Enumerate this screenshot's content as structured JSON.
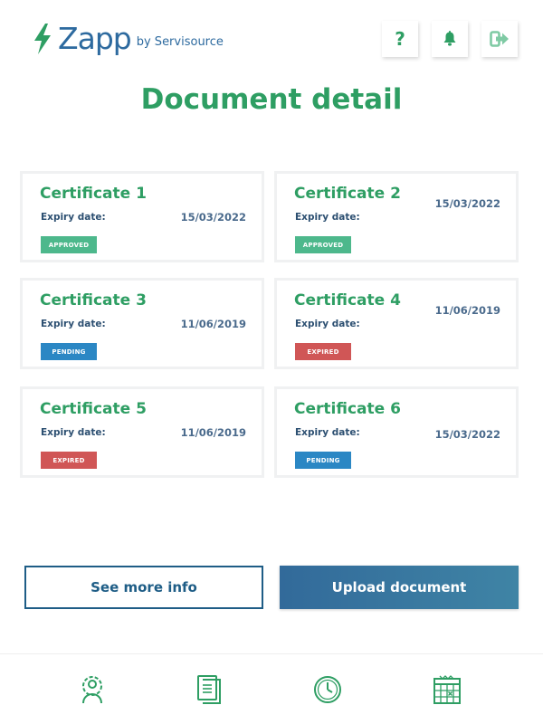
{
  "header": {
    "logo_word": "Zapp",
    "logo_by": "by Servisource",
    "help_label": "?"
  },
  "page": {
    "title": "Document detail"
  },
  "cards": [
    {
      "title": "Certificate 1",
      "expiry_label": "Expiry date:",
      "expiry_date": "15/03/2022",
      "status": "APPROVED"
    },
    {
      "title": "Certificate 2",
      "expiry_label": "Expiry date:",
      "expiry_date": "15/03/2022",
      "status": "APPROVED"
    },
    {
      "title": "Certificate 3",
      "expiry_label": "Expiry date:",
      "expiry_date": "11/06/2019",
      "status": "PENDING"
    },
    {
      "title": "Certificate 4",
      "expiry_label": "Expiry date:",
      "expiry_date": "11/06/2019",
      "status": "EXPIRED"
    },
    {
      "title": "Certificate 5",
      "expiry_label": "Expiry date:",
      "expiry_date": "11/06/2019",
      "status": "EXPIRED"
    },
    {
      "title": "Certificate 6",
      "expiry_label": "Expiry date:",
      "expiry_date": "15/03/2022",
      "status": "PENDING"
    }
  ],
  "actions": {
    "see_more_label": "See more info",
    "upload_label": "Upload document"
  },
  "nav": {
    "items": [
      {
        "icon": "user-settings-icon"
      },
      {
        "icon": "document-icon"
      },
      {
        "icon": "clock-icon"
      },
      {
        "icon": "calendar-icon"
      }
    ]
  },
  "colors": {
    "brand_green": "#2e9e63",
    "brand_blue": "#2d6a9f",
    "approved": "#4db88c",
    "pending": "#2b87c4",
    "expired": "#d05656"
  }
}
